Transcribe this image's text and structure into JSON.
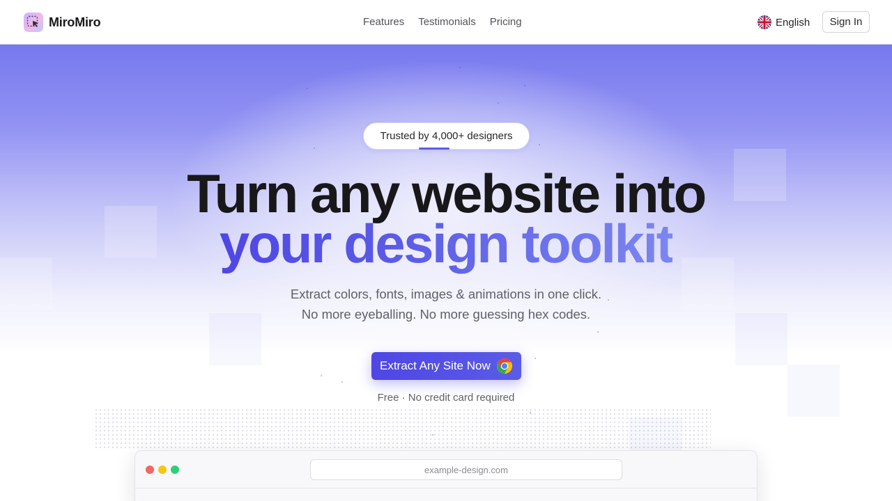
{
  "brand": {
    "name": "MiroMiro",
    "logo_icon": "selection-cursor-icon"
  },
  "nav": {
    "items": [
      {
        "label": "Features"
      },
      {
        "label": "Testimonials"
      },
      {
        "label": "Pricing"
      }
    ]
  },
  "header": {
    "language": {
      "label": "English",
      "icon": "uk-flag-icon"
    },
    "signin_label": "Sign In"
  },
  "hero": {
    "badge": "Trusted by 4,000+ designers",
    "headline_line1": "Turn any website into",
    "headline_line2": "your design toolkit",
    "subtitle_line1": "Extract colors, fonts, images & animations in one click.",
    "subtitle_line2": "No more eyeballing. No more guessing hex codes.",
    "cta_label": "Extract Any Site Now",
    "cta_icon": "chrome-icon",
    "note": "Free · No credit card required"
  },
  "browser_preview": {
    "url": "example-design.com"
  },
  "colors": {
    "accent": "#4f46e5",
    "accent_light": "#7c86f0",
    "hero_top": "#7778ee",
    "text_dark": "#18181b",
    "text_muted": "#5f5f68"
  }
}
